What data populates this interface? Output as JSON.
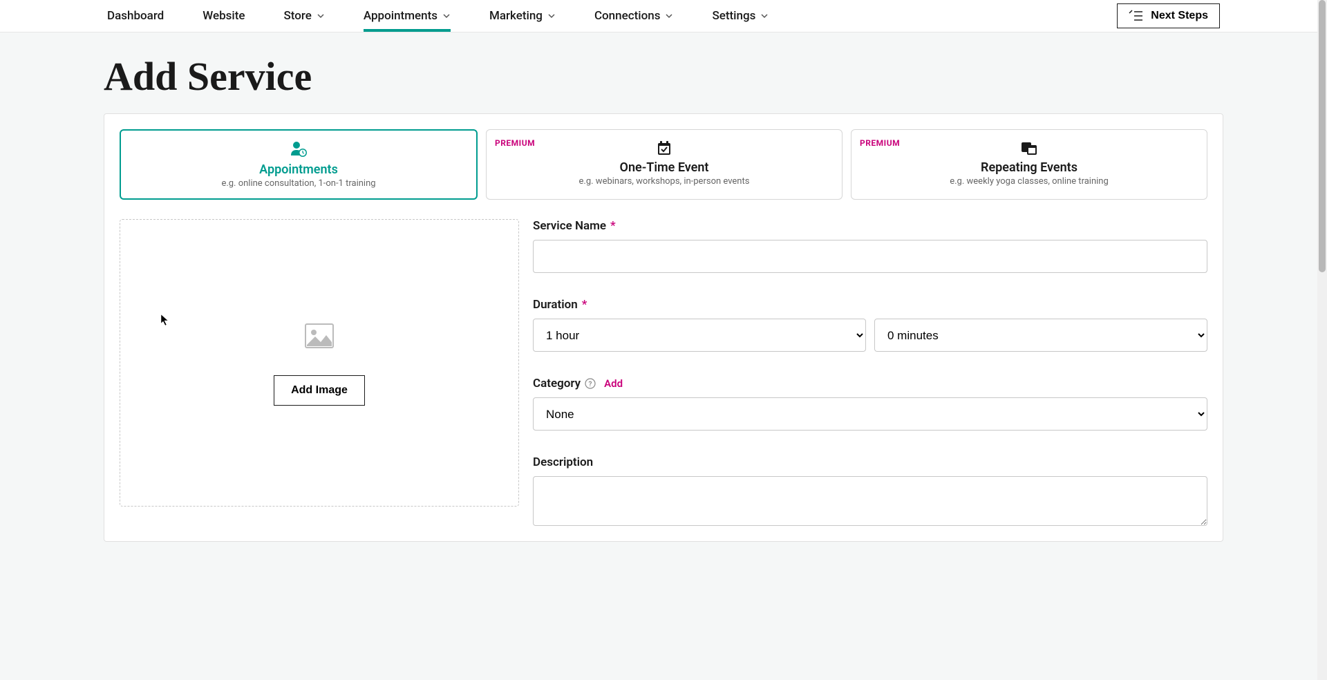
{
  "nav": {
    "items": [
      {
        "label": "Dashboard",
        "has_dropdown": false
      },
      {
        "label": "Website",
        "has_dropdown": false
      },
      {
        "label": "Store",
        "has_dropdown": true
      },
      {
        "label": "Appointments",
        "has_dropdown": true
      },
      {
        "label": "Marketing",
        "has_dropdown": true
      },
      {
        "label": "Connections",
        "has_dropdown": true
      },
      {
        "label": "Settings",
        "has_dropdown": true
      }
    ],
    "next_steps": "Next Steps"
  },
  "page": {
    "title": "Add Service"
  },
  "type_cards": [
    {
      "title": "Appointments",
      "subtitle": "e.g. online consultation, 1-on-1 training",
      "premium": false,
      "selected": true
    },
    {
      "title": "One-Time Event",
      "subtitle": "e.g. webinars, workshops, in-person events",
      "premium": true,
      "selected": false
    },
    {
      "title": "Repeating Events",
      "subtitle": "e.g. weekly yoga classes, online training",
      "premium": true,
      "selected": false
    }
  ],
  "badges": {
    "premium": "PREMIUM"
  },
  "image_upload": {
    "button": "Add Image"
  },
  "form": {
    "service_name": {
      "label": "Service Name",
      "value": ""
    },
    "duration": {
      "label": "Duration",
      "hours": "1 hour",
      "minutes": "0 minutes"
    },
    "category": {
      "label": "Category",
      "add_link": "Add",
      "value": "None"
    },
    "description": {
      "label": "Description",
      "value": ""
    }
  }
}
